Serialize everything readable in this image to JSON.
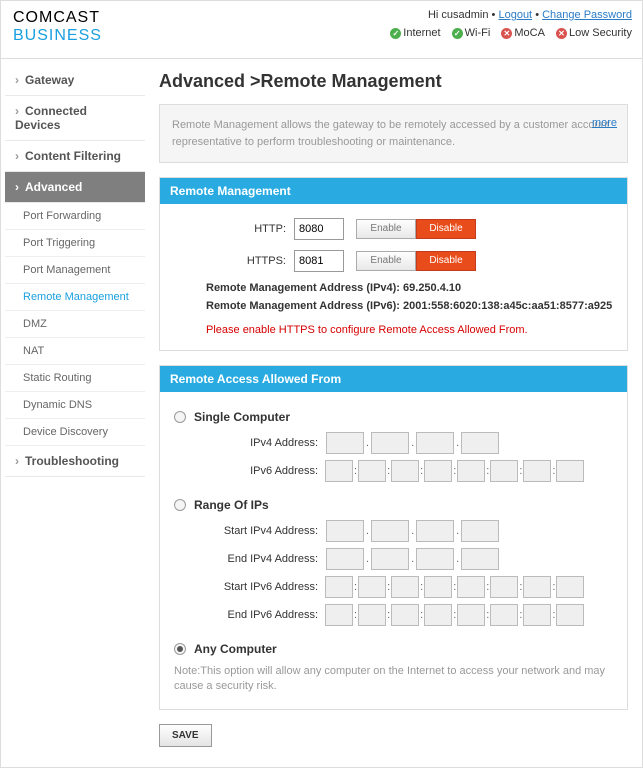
{
  "brand": {
    "line1": "COMCAST",
    "line2": "BUSINESS"
  },
  "user": {
    "greeting": "Hi cusadmin",
    "logout": "Logout",
    "change_pw": "Change Password",
    "sep": "•"
  },
  "status": {
    "items": [
      {
        "label": "Internet",
        "ok": true
      },
      {
        "label": "Wi-Fi",
        "ok": true
      },
      {
        "label": "MoCA",
        "ok": false
      },
      {
        "label": "Low Security",
        "ok": false
      }
    ]
  },
  "nav": {
    "gateway": "Gateway",
    "connected": "Connected Devices",
    "filtering": "Content Filtering",
    "advanced": "Advanced",
    "subs": {
      "pf": "Port Forwarding",
      "pt": "Port Triggering",
      "pm": "Port Management",
      "rm": "Remote Management",
      "dmz": "DMZ",
      "nat": "NAT",
      "sr": "Static Routing",
      "ddns": "Dynamic DNS",
      "dd": "Device Discovery"
    },
    "trouble": "Troubleshooting"
  },
  "page": {
    "title": "Advanced >Remote Management",
    "desc": "Remote Management allows the gateway to be remotely accessed by a customer account representative to perform troubleshooting or maintenance.",
    "more": "more"
  },
  "remote_mgmt": {
    "heading": "Remote Management",
    "http_label": "HTTP:",
    "http_port": "8080",
    "https_label": "HTTPS:",
    "https_port": "8081",
    "enable": "Enable",
    "disable": "Disable",
    "ipv4_line": "Remote Management Address (IPv4): 69.250.4.10",
    "ipv6_line": "Remote Management Address (IPv6): 2001:558:6020:138:a45c:aa51:8577:a925",
    "warn": "Please enable HTTPS to configure Remote Access Allowed From."
  },
  "access": {
    "heading": "Remote Access Allowed From",
    "single": "Single Computer",
    "ipv4_addr": "IPv4 Address:",
    "ipv6_addr": "IPv6 Address:",
    "range": "Range Of IPs",
    "start4": "Start IPv4 Address:",
    "end4": "End IPv4 Address:",
    "start6": "Start IPv6 Address:",
    "end6": "End IPv6 Address:",
    "any": "Any Computer",
    "note": "Note:This option will allow any computer on the Internet to access your network and may cause a security risk."
  },
  "save": "SAVE"
}
